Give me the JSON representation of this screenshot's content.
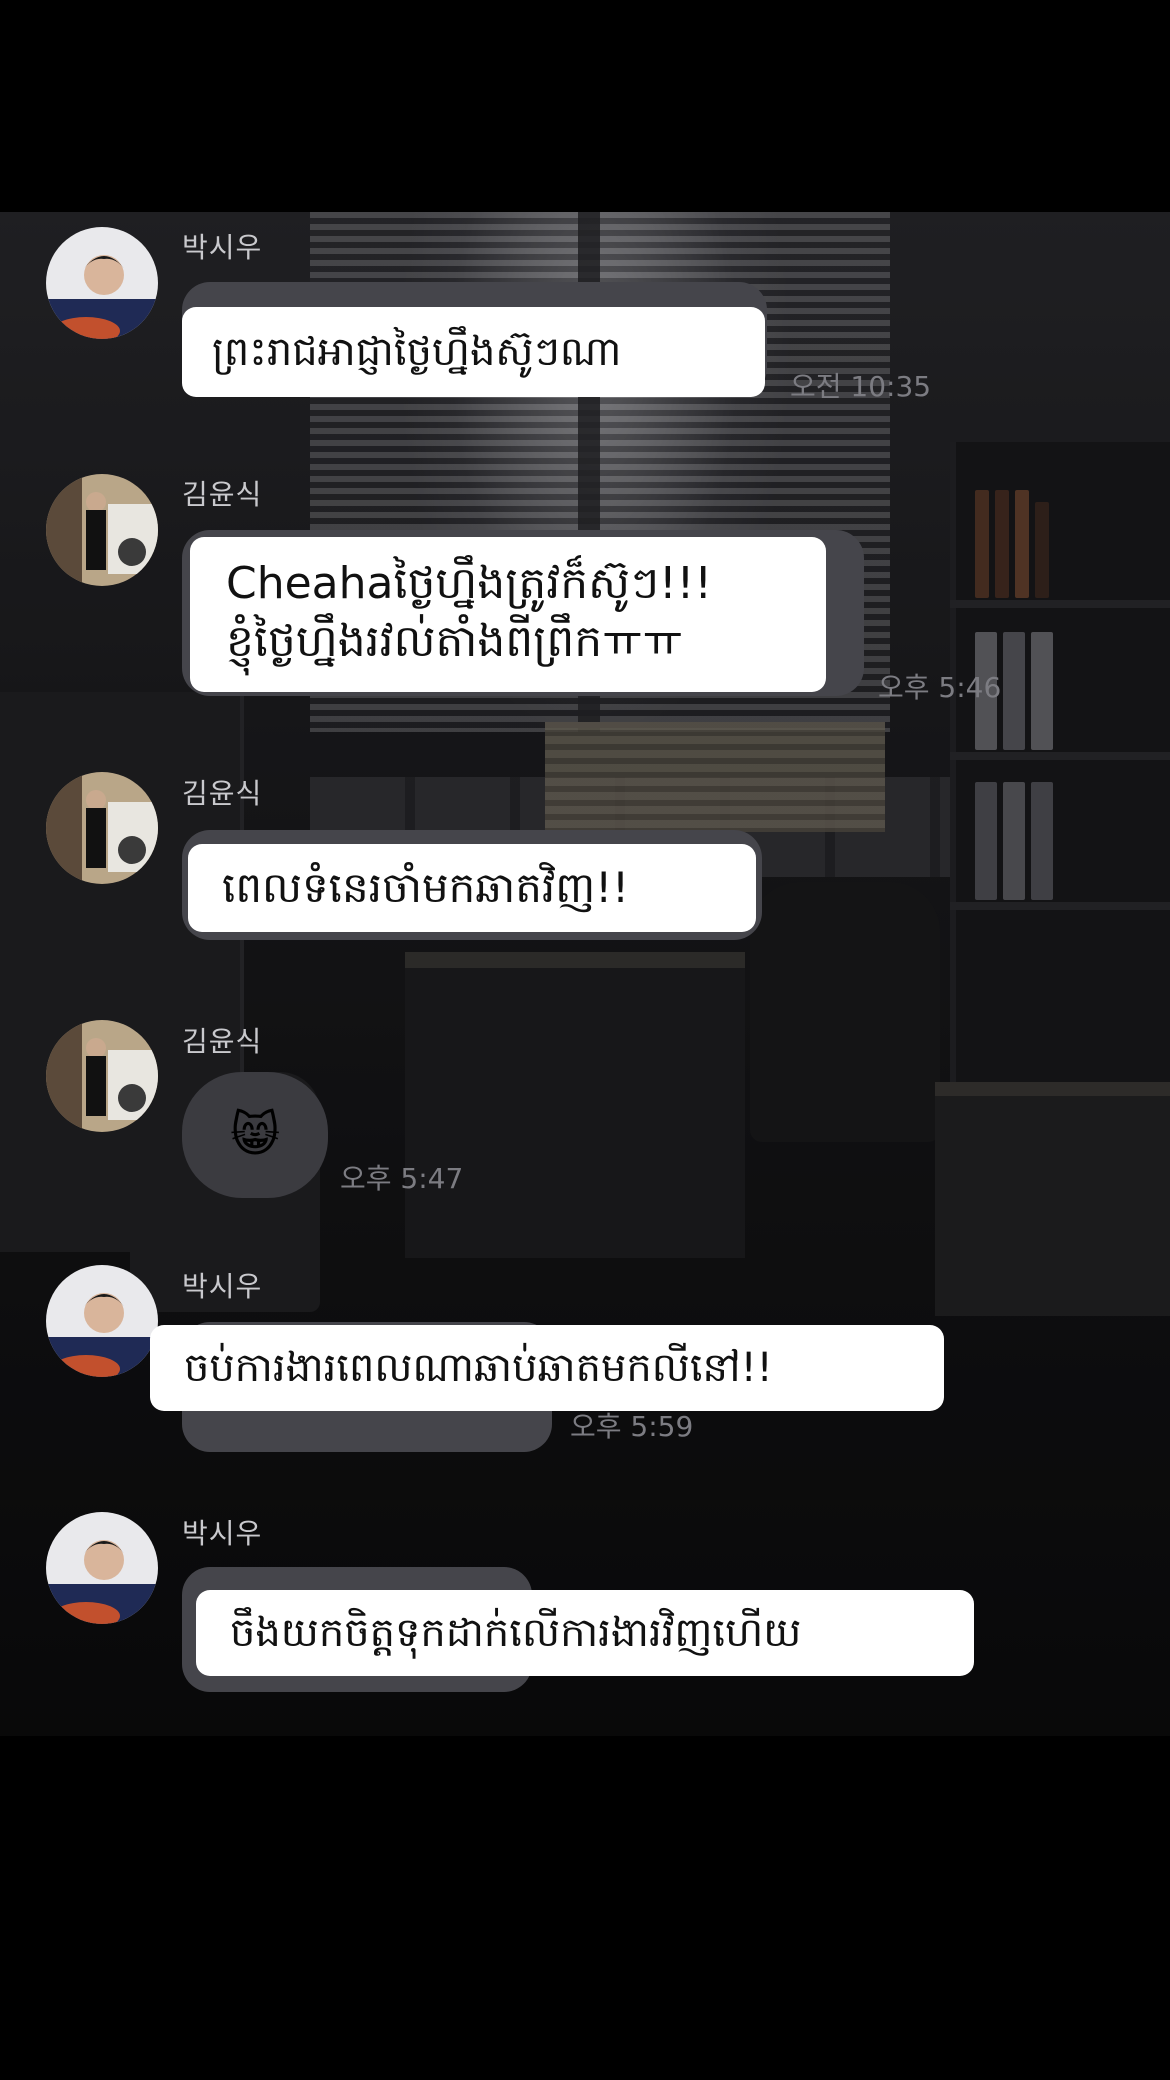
{
  "chat": {
    "messages": [
      {
        "sender": "박시우",
        "text": "ព្រះរាជអាជ្ញាថ្ងៃហ្នឹងស៊ូៗណា",
        "time": "오전 10:35"
      },
      {
        "sender": "김윤식",
        "line1": "Cheahaថ្ងៃហ្នឹងត្រូវក៏ស៊ូៗ!!!",
        "line2": "ខ្ញុំថ្ងៃហ្នឹងរវល់តាំងពីព្រឹកㅠㅠ",
        "time": "오후 5:46"
      },
      {
        "sender": "김윤식",
        "text": "ពេលទំនេរចាំមកឆាតវិញ!!"
      },
      {
        "sender": "김윤식",
        "emoji": "😸",
        "time": "오후 5:47"
      },
      {
        "sender": "박시우",
        "text": "ចប់ការងារពេលណាឆាប់ឆាតមកលីនៅ!!",
        "time": "오후 5:59"
      },
      {
        "sender": "박시우",
        "text": "ចឹងយកចិត្តទុកដាក់លើការងារវិញហើយ"
      }
    ]
  },
  "icons": {
    "avatar_park": "avatar-park-siwoo",
    "avatar_kim": "avatar-kim-yunsik"
  },
  "colors": {
    "bubble_bg": "#ffffff",
    "ghost_bubble": "#45454b",
    "time_text": "#7c7c82",
    "sender_text": "#c9c9cd"
  }
}
